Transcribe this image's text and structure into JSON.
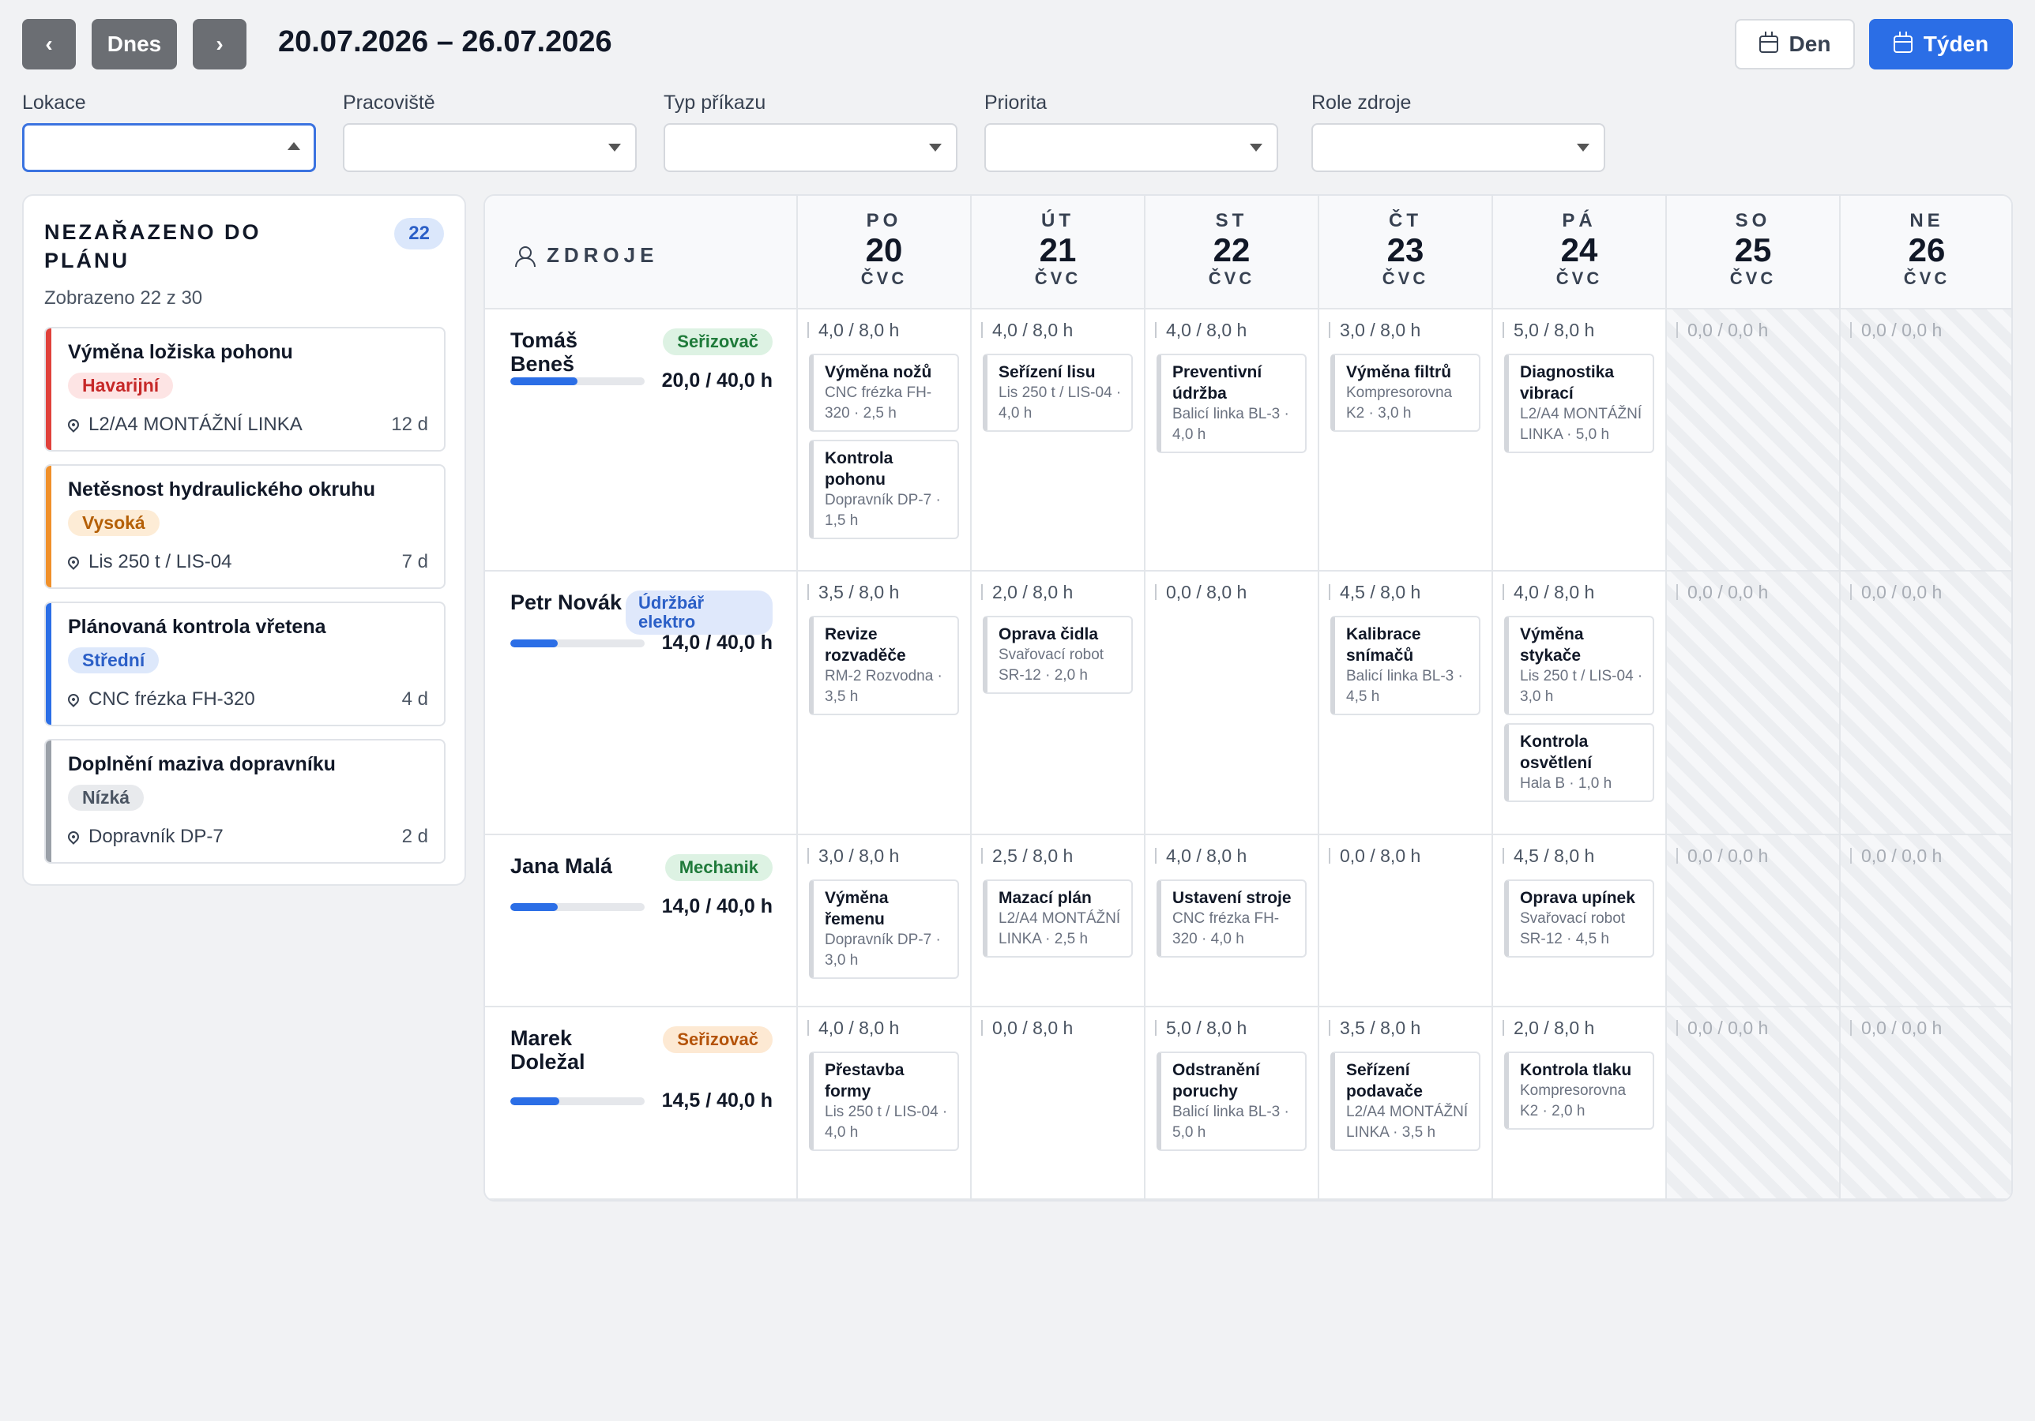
{
  "header": {
    "prev": "‹",
    "today": "Dnes",
    "next": "›",
    "range": "20.07.2026 – 26.07.2026",
    "view_day": "Den",
    "view_week": "Týden"
  },
  "filters": [
    {
      "label": "Lokace",
      "value": "",
      "open": true
    },
    {
      "label": "Pracoviště",
      "value": ""
    },
    {
      "label": "Typ příkazu",
      "value": ""
    },
    {
      "label": "Priorita",
      "value": ""
    },
    {
      "label": "Role zdroje",
      "value": ""
    }
  ],
  "unplanned": {
    "title": "NEZAŘAZENO DO PLÁNU",
    "count": "22",
    "shown": "Zobrazeno 22 z 30",
    "items": [
      {
        "title": "Výměna ložiska pohonu",
        "priority": "Havarijní",
        "location": "L2/A4 MONTÁŽNÍ LINKA",
        "age": "12 d"
      },
      {
        "title": "Netěsnost hydraulického okruhu",
        "priority": "Vysoká",
        "location": "Lis 250 t / LIS-04",
        "age": "7 d"
      },
      {
        "title": "Plánovaná kontrola vřetena",
        "priority": "Střední",
        "location": "CNC frézka FH-320",
        "age": "4 d"
      },
      {
        "title": "Doplnění maziva dopravníku",
        "priority": "Nízká",
        "location": "Dopravník DP-7",
        "age": "2 d"
      }
    ]
  },
  "colors": {
    "accent": "#2b6ee6",
    "priority": {
      "Havarijní": {
        "bar": "#e0413b",
        "bg": "#fde4e4",
        "fg": "#c62828"
      },
      "Vysoká": {
        "bar": "#f0902a",
        "bg": "#fdecd6",
        "fg": "#b45f06"
      },
      "Střední": {
        "bar": "#2b6ee6",
        "bg": "#dde8fb",
        "fg": "#2b5fc7"
      },
      "Nízká": {
        "bar": "#9aa0a8",
        "bg": "#e8eaed",
        "fg": "#4b5563"
      }
    },
    "roles": {
      "Seřizovač": {
        "bg": "#ddf2e3",
        "fg": "#1f7a3a"
      },
      "Údržbář elektro": {
        "bg": "#dfe8fb",
        "fg": "#2b5fc7"
      },
      "Mechanik": {
        "bg": "#ddf2e3",
        "fg": "#1f7a3a"
      },
      "Seřizovač ": {
        "bg": "#fde9d3",
        "fg": "#b4530a"
      }
    }
  },
  "grid": {
    "resources_label": "ZDROJE",
    "days": [
      {
        "name": "PO",
        "num": "20",
        "month": "ČVC",
        "weekend": false
      },
      {
        "name": "ÚT",
        "num": "21",
        "month": "ČVC",
        "weekend": false
      },
      {
        "name": "ST",
        "num": "22",
        "month": "ČVC",
        "weekend": false
      },
      {
        "name": "ČT",
        "num": "23",
        "month": "ČVC",
        "weekend": false
      },
      {
        "name": "PÁ",
        "num": "24",
        "month": "ČVC",
        "weekend": false
      },
      {
        "name": "SO",
        "num": "25",
        "month": "ČVC",
        "weekend": true
      },
      {
        "name": "NE",
        "num": "26",
        "month": "ČVC",
        "weekend": true
      }
    ],
    "resources": [
      {
        "name": "Tomáš Beneš",
        "role": "Seřizovač",
        "hours": "20,0 / 40,0 h",
        "load": 0.5,
        "cells": [
          {
            "load": "4,0 / 8,0 h",
            "jobs": [
              {
                "title": "Výměna nožů",
                "detail": "CNC frézka FH-320 · 2,5 h"
              },
              {
                "title": "Kontrola pohonu",
                "detail": "Dopravník DP-7 · 1,5 h"
              }
            ]
          },
          {
            "load": "4,0 / 8,0 h",
            "jobs": [
              {
                "title": "Seřízení lisu",
                "detail": "Lis 250 t / LIS-04 · 4,0 h"
              }
            ]
          },
          {
            "load": "4,0 / 8,0 h",
            "jobs": [
              {
                "title": "Preventivní údržba",
                "detail": "Balicí linka BL-3 · 4,0 h"
              }
            ]
          },
          {
            "load": "3,0 / 8,0 h",
            "jobs": [
              {
                "title": "Výměna filtrů",
                "detail": "Kompresorovna K2 · 3,0 h"
              }
            ]
          },
          {
            "load": "5,0 / 8,0 h",
            "jobs": [
              {
                "title": "Diagnostika vibrací",
                "detail": "L2/A4 MONTÁŽNÍ LINKA · 5,0 h"
              }
            ]
          },
          {
            "load": "0,0 / 0,0 h",
            "jobs": []
          },
          {
            "load": "0,0 / 0,0 h",
            "jobs": []
          }
        ]
      },
      {
        "name": "Petr Novák",
        "role": "Údržbář elektro",
        "hours": "14,0 / 40,0 h",
        "load": 0.35,
        "cells": [
          {
            "load": "3,5 / 8,0 h",
            "jobs": [
              {
                "title": "Revize rozvaděče",
                "detail": "RM-2 Rozvodna · 3,5 h"
              }
            ]
          },
          {
            "load": "2,0 / 8,0 h",
            "jobs": [
              {
                "title": "Oprava čidla",
                "detail": "Svařovací robot SR-12 · 2,0 h"
              }
            ]
          },
          {
            "load": "0,0 / 8,0 h",
            "jobs": []
          },
          {
            "load": "4,5 / 8,0 h",
            "jobs": [
              {
                "title": "Kalibrace snímačů",
                "detail": "Balicí linka BL-3 · 4,5 h"
              }
            ]
          },
          {
            "load": "4,0 / 8,0 h",
            "jobs": [
              {
                "title": "Výměna stykače",
                "detail": "Lis 250 t / LIS-04 · 3,0 h"
              },
              {
                "title": "Kontrola osvětlení",
                "detail": "Hala B · 1,0 h"
              }
            ]
          },
          {
            "load": "0,0 / 0,0 h",
            "jobs": []
          },
          {
            "load": "0,0 / 0,0 h",
            "jobs": []
          }
        ]
      },
      {
        "name": "Jana Malá",
        "role": "Mechanik",
        "hours": "14,0 / 40,0 h",
        "load": 0.35,
        "cells": [
          {
            "load": "3,0 / 8,0 h",
            "jobs": [
              {
                "title": "Výměna řemenu",
                "detail": "Dopravník DP-7 · 3,0 h"
              }
            ]
          },
          {
            "load": "2,5 / 8,0 h",
            "jobs": [
              {
                "title": "Mazací plán",
                "detail": "L2/A4 MONTÁŽNÍ LINKA · 2,5 h"
              }
            ]
          },
          {
            "load": "4,0 / 8,0 h",
            "jobs": [
              {
                "title": "Ustavení stroje",
                "detail": "CNC frézka FH-320 · 4,0 h"
              }
            ]
          },
          {
            "load": "0,0 / 8,0 h",
            "jobs": []
          },
          {
            "load": "4,5 / 8,0 h",
            "jobs": [
              {
                "title": "Oprava upínek",
                "detail": "Svařovací robot SR-12 · 4,5 h"
              }
            ]
          },
          {
            "load": "0,0 / 0,0 h",
            "jobs": []
          },
          {
            "load": "0,0 / 0,0 h",
            "jobs": []
          }
        ]
      },
      {
        "name": "Marek Doležal",
        "role": "Seřizovač ",
        "hours": "14,5 / 40,0 h",
        "load": 0.3625,
        "cells": [
          {
            "load": "4,0 / 8,0 h",
            "jobs": [
              {
                "title": "Přestavba formy",
                "detail": "Lis 250 t / LIS-04 · 4,0 h"
              }
            ]
          },
          {
            "load": "0,0 / 8,0 h",
            "jobs": []
          },
          {
            "load": "5,0 / 8,0 h",
            "jobs": [
              {
                "title": "Odstranění poruchy",
                "detail": "Balicí linka BL-3 · 5,0 h"
              }
            ]
          },
          {
            "load": "3,5 / 8,0 h",
            "jobs": [
              {
                "title": "Seřízení podavače",
                "detail": "L2/A4 MONTÁŽNÍ LINKA · 3,5 h"
              }
            ]
          },
          {
            "load": "2,0 / 8,0 h",
            "jobs": [
              {
                "title": "Kontrola tlaku",
                "detail": "Kompresorovna K2 · 2,0 h"
              }
            ]
          },
          {
            "load": "0,0 / 0,0 h",
            "jobs": []
          },
          {
            "load": "0,0 / 0,0 h",
            "jobs": []
          }
        ]
      }
    ]
  }
}
